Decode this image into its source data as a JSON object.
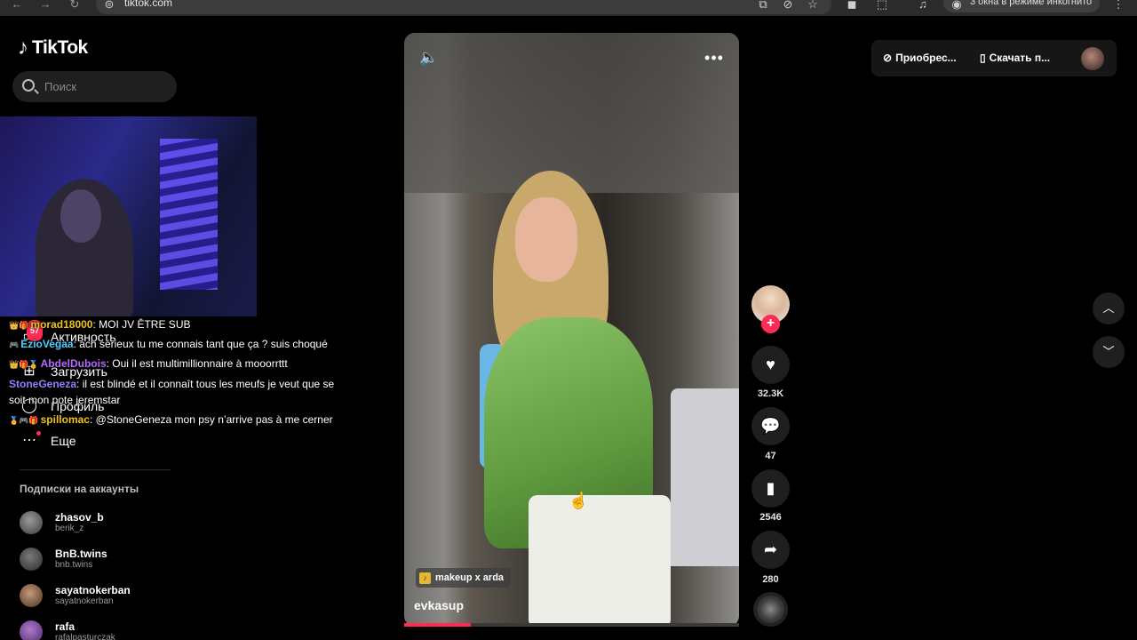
{
  "browser": {
    "url": "tiktok.com",
    "incognito_label": "3 окна в режиме инкогнито",
    "back_icon": "arrow-left-icon",
    "forward_icon": "arrow-right-icon",
    "reload_icon": "reload-icon"
  },
  "app": {
    "logo_text": "TikTok",
    "search_placeholder": "Поиск"
  },
  "sidebar": {
    "items": [
      {
        "label": "Активность",
        "icon": "inbox-icon",
        "badge": "57"
      },
      {
        "label": "Загрузить",
        "icon": "upload-icon"
      },
      {
        "label": "Профиль",
        "icon": "profile-icon"
      },
      {
        "label": "Еще",
        "icon": "more-icon"
      }
    ],
    "following_title": "Подписки на аккаунты",
    "following": [
      {
        "name": "zhasov_b",
        "handle": "berik_z"
      },
      {
        "name": "BnB.twins",
        "handle": "bnb.twins"
      },
      {
        "name": "sayatnokerban",
        "handle": "sayatnokerban"
      },
      {
        "name": "rafa",
        "handle": "rafalpasturczak"
      }
    ]
  },
  "chat": [
    {
      "user": "morad18000",
      "text": ": MOI JV ÊTRE SUB",
      "color": "#f0c419"
    },
    {
      "user": "EzioVegaa",
      "text": ": ach sérieux tu me connais tant que ça ? suis choqué",
      "color": "#4fd1ff"
    },
    {
      "user": "AbdelDubois",
      "text": ": Oui il est multimillionnaire à mooorrttt",
      "color": "#b46bff"
    },
    {
      "user": "StoneGeneza",
      "text": ": il est blindé et il connaît tous les meufs je veut que se",
      "color": "#9b7bff"
    },
    {
      "user": "",
      "text": "soit mon pote jeremstar",
      "color": "#ffffff"
    },
    {
      "user": "spillomac",
      "text": ": @StoneGeneza mon psy n’arrive pas à me cerner",
      "color": "#f0c419"
    }
  ],
  "video": {
    "author": "evkasup",
    "music": "makeup x arda",
    "progress": 0.2,
    "likes": "32.3K",
    "comments": "47",
    "saves": "2546",
    "shares": "280"
  },
  "topbar": {
    "coins_label": "Приобрес...",
    "download_label": "Скачать п..."
  },
  "colors": {
    "accent": "#fe2c55",
    "background": "#000000"
  }
}
